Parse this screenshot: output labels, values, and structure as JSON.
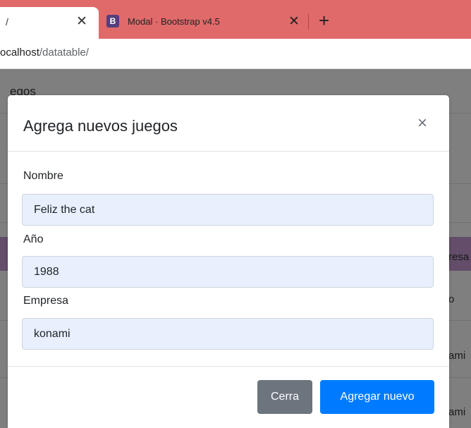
{
  "browser": {
    "active_tab": {
      "title": "/",
      "close": "✕"
    },
    "inactive_tab": {
      "favicon": "B",
      "title": "Modal · Bootstrap v4.5",
      "close": "✕"
    },
    "new_tab": "+",
    "url_host": "ocalhost",
    "url_path": "/datatable/"
  },
  "background_page": {
    "title_fragment": "egos",
    "header_fragment": "resa",
    "row1_fragment": "o",
    "row2_fragment": "ami",
    "row3_fragment": "ami",
    "header_color": "#c79ad5"
  },
  "modal": {
    "title": "Agrega nuevos juegos",
    "close": "×",
    "fields": [
      {
        "label": "Nombre",
        "value": "Feliz the cat"
      },
      {
        "label": "Año",
        "value": "1988"
      },
      {
        "label": "Empresa",
        "value": "konami"
      }
    ],
    "buttons": {
      "cancel": "Cerra",
      "submit": "Agregar nuevo"
    }
  },
  "colors": {
    "tabbar": "#e06a6a",
    "primary": "#007bff",
    "secondary": "#6c757d",
    "autofill": "#e8f0fe"
  }
}
